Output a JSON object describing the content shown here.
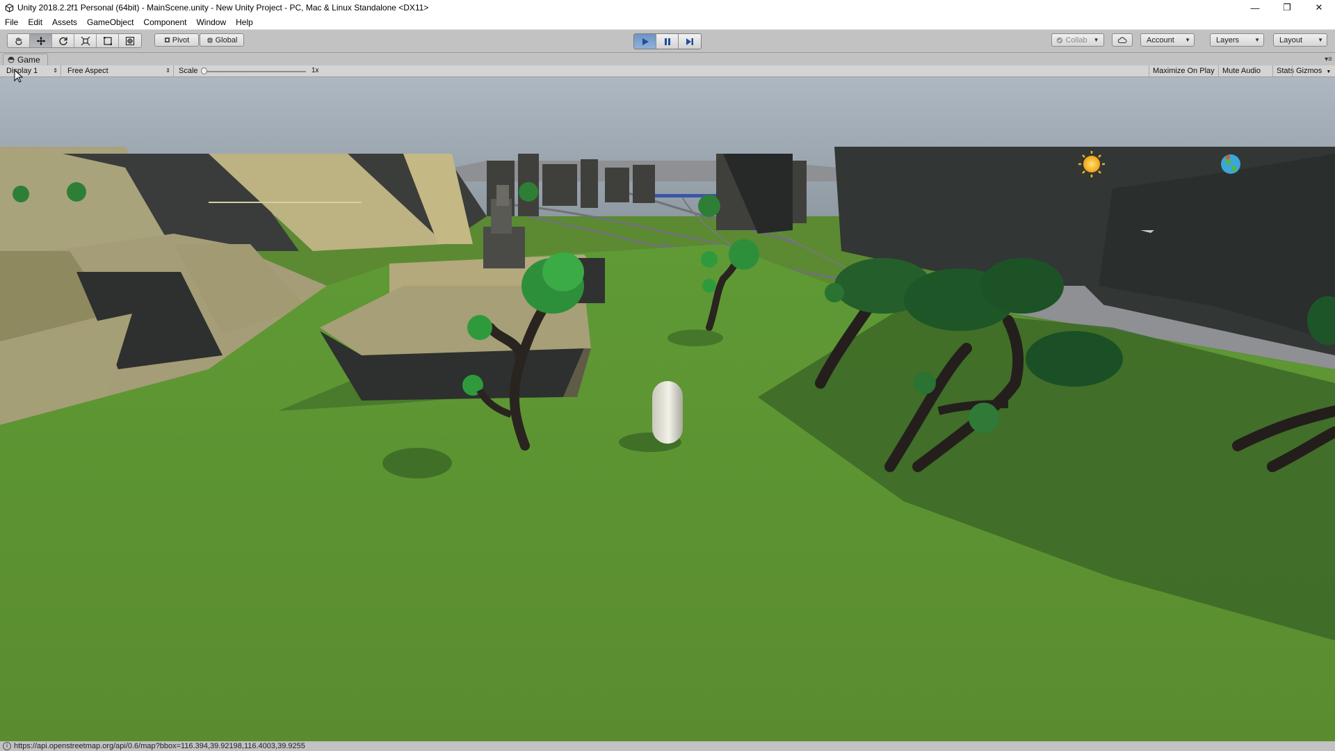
{
  "window": {
    "title": "Unity 2018.2.2f1 Personal (64bit) - MainScene.unity - New Unity Project - PC, Mac & Linux Standalone <DX11>",
    "minimize": "—",
    "maximize": "❐",
    "close": "✕"
  },
  "menu": [
    "File",
    "Edit",
    "Assets",
    "GameObject",
    "Component",
    "Window",
    "Help"
  ],
  "toolbar": {
    "pivot_label": "Pivot",
    "global_label": "Global",
    "collab_label": "Collab",
    "account_label": "Account",
    "layers_label": "Layers",
    "layout_label": "Layout",
    "play_state": "playing"
  },
  "game_panel": {
    "tab_label": "Game",
    "display": "Display 1",
    "aspect": "Free Aspect",
    "scale_label": "Scale",
    "scale_value": "1x",
    "maximize_on_play": "Maximize On Play",
    "mute_audio": "Mute Audio",
    "stats": "Stats",
    "gizmos": "Gizmos"
  },
  "status": {
    "text": "https://api.openstreetmap.org/api/0.6/map?bbox=116.394,39.92198,116.4003,39.9255"
  },
  "colors": {
    "grass": "#5b8a32",
    "play_active": "#7ea2d2"
  }
}
